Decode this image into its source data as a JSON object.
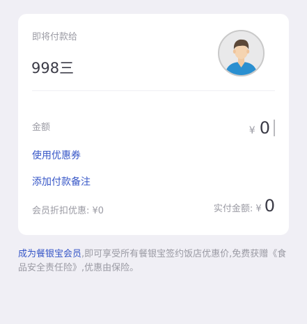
{
  "payee": {
    "label": "即将付款给",
    "name": "998三"
  },
  "amount": {
    "label": "金额",
    "currency_symbol": "¥",
    "value": "0"
  },
  "links": {
    "coupon": "使用优惠券",
    "remark": "添加付款备注"
  },
  "summary": {
    "member_discount": "会员折扣优惠: ¥0",
    "actual_label": "实付金额: ¥",
    "actual_value": "0"
  },
  "notice": {
    "member_link": "成为餐银宝会员",
    "text": ",即可享受所有餐银宝签约饭店优惠价,免费获赠《食品安全责任险》,优惠由保险。"
  },
  "colors": {
    "accent": "#3656c7",
    "background": "#f0eff5",
    "muted_text": "#9a9aa3",
    "main_text": "#3a3a46"
  }
}
